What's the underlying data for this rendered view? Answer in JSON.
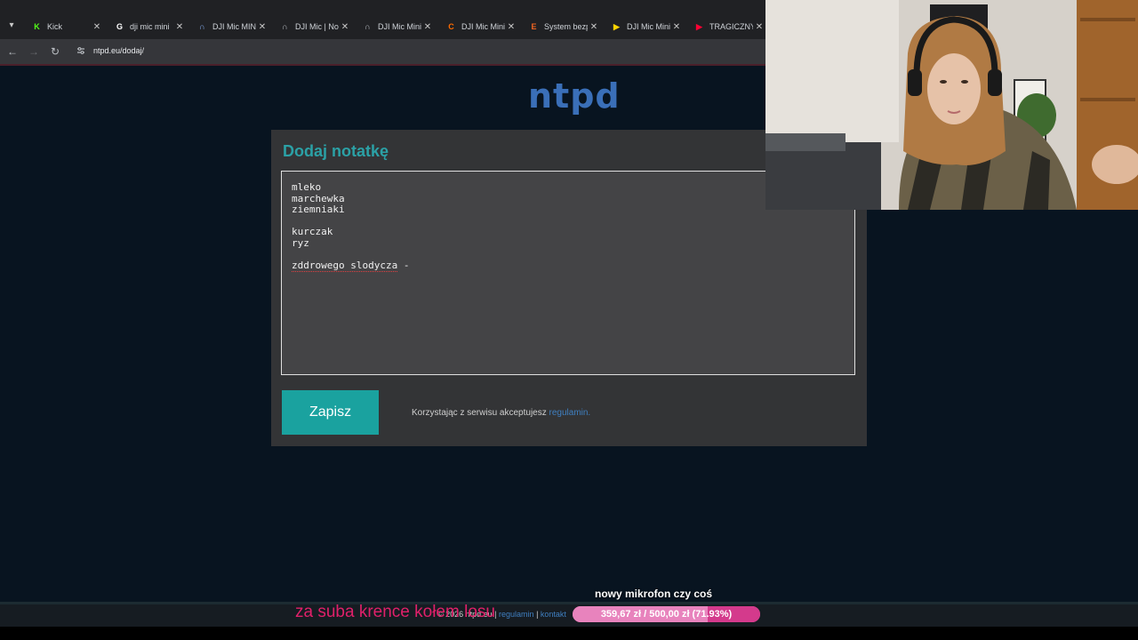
{
  "browser": {
    "tabs": [
      {
        "title": "Kick",
        "favicon_color": "#53fc18",
        "glyph": "K"
      },
      {
        "title": "dji mic mini",
        "favicon_color": "#ffffff",
        "glyph": "G"
      },
      {
        "title": "DJI Mic MINI",
        "favicon_color": "#8ab4f8",
        "glyph": "∩"
      },
      {
        "title": "DJI Mic | No",
        "favicon_color": "#bdc1c6",
        "glyph": "∩"
      },
      {
        "title": "DJI Mic Mini",
        "favicon_color": "#bdc1c6",
        "glyph": "∩"
      },
      {
        "title": "DJI Mic Mini",
        "favicon_color": "#ff6a00",
        "glyph": "C"
      },
      {
        "title": "System bezp",
        "favicon_color": "#f26522",
        "glyph": "E"
      },
      {
        "title": "DJI Mic Mini",
        "favicon_color": "#ffd400",
        "glyph": "▶"
      },
      {
        "title": "TRAGICZNY",
        "favicon_color": "#ff0033",
        "glyph": "▶"
      }
    ],
    "url": "ntpd.eu/dodaj/"
  },
  "page": {
    "logo": "ntpd",
    "title": "Dodaj notatkę",
    "note_lines": [
      "mleko",
      "marchewka",
      "ziemniaki",
      "",
      "kurczak",
      "ryz",
      ""
    ],
    "note_last_line": "zddrowego slodycza",
    "note_last_suffix": " -",
    "save_label": "Zapisz",
    "accept_text": "Korzystając z serwisu akceptujesz ",
    "accept_link": "regulamin."
  },
  "footer": {
    "copyright": "© 2026 ntpd.eu | ",
    "link1": "regulamin",
    "sep": " | ",
    "link2": "kontakt"
  },
  "overlay": {
    "pink_text": "za suba krence kołem losu",
    "goal_label": "nowy mikrofon czy coś",
    "goal_text": "359,67 zł / 500,00 zł (71.93%)",
    "goal_fraction": 0.7193
  }
}
